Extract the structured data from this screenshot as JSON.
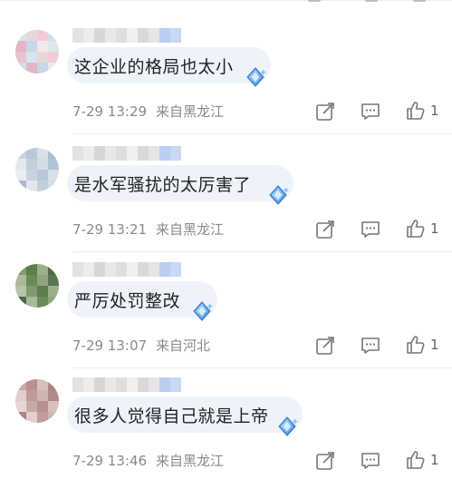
{
  "comments": [
    {
      "text": "这企业的格局也太小",
      "time": "7-29 13:29",
      "location": "来自黑龙江",
      "likes": "1",
      "avatar_colors": [
        "#d9e3ee",
        "#e7d6da",
        "#f1ccd8",
        "#cfdfe8",
        "#e2b6c4",
        "#c9d6e6",
        "#f2e7ec",
        "#dbe7ef",
        "#e8c2cf"
      ]
    },
    {
      "text": "是水军骚扰的太厉害了",
      "time": "7-29 13:21",
      "location": "来自黑龙江",
      "likes": "1",
      "avatar_colors": [
        "#c7d3df",
        "#b9c8d8",
        "#d8e0ea",
        "#a9bccf",
        "#e4e8ee",
        "#c3cfdb",
        "#d2dbe6",
        "#b2c3d6",
        "#e9edf2"
      ]
    },
    {
      "text": "严厉处罚整改",
      "time": "7-29 13:07",
      "location": "来自河北",
      "likes": "1",
      "avatar_colors": [
        "#7f9a6d",
        "#5d7d4e",
        "#9bb08a",
        "#4e6b45",
        "#a9b99a",
        "#6b8a5a",
        "#8fa47e",
        "#5a7552",
        "#b5c3a6"
      ]
    },
    {
      "text": "很多人觉得自己就是上帝",
      "time": "7-29 13:46",
      "location": "来自黑龙江",
      "likes": "1",
      "avatar_colors": [
        "#c9a9a6",
        "#b9908d",
        "#d8c0bd",
        "#a98480",
        "#e0cfcc",
        "#c19b97",
        "#d2b4b0",
        "#b08a86",
        "#e6d7d5"
      ]
    }
  ],
  "name_mosaic_colors": [
    "#e2e2e2",
    "#ececec",
    "#d6d6d6",
    "#e8e8e8",
    "#dedede",
    "#f0f0f0",
    "#d9d9d9",
    "#e5e5e5",
    "#b9cef0",
    "#c8d9f4"
  ],
  "icons": {
    "reply": "share-edit-icon",
    "comment": "comment-bubble-icon",
    "like": "thumbs-up-icon",
    "badge": "diamond-gem-icon"
  }
}
